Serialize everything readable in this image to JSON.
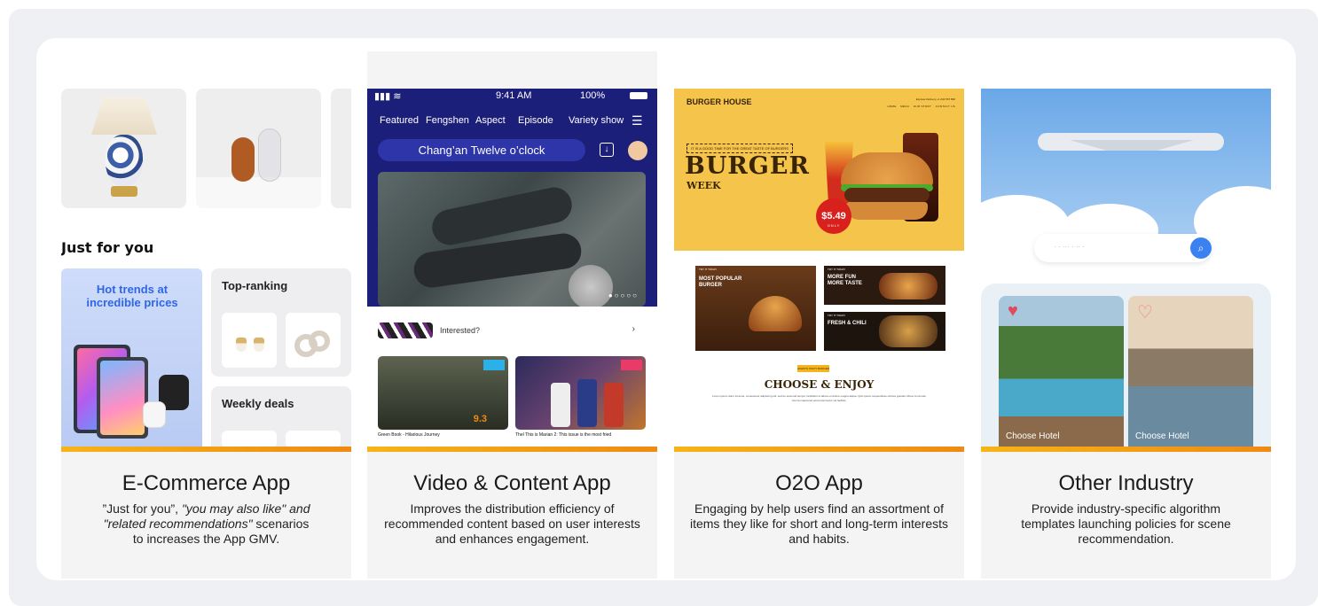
{
  "cards": [
    {
      "id": "ecommerce",
      "title": "E-Commerce App",
      "desc_line1": "”Just for you”, ",
      "desc_line1_italic": "\"you may also like\" and",
      "desc_line2_italic": "\"related recommendations\"",
      "desc_line2": " scenarios",
      "desc_line3": "to increases the App GMV.",
      "screen": {
        "section_title": "Just for you",
        "hot_text": "Hot trends at incredible prices",
        "rank_label": "Top-ranking",
        "deals_label": "Weekly deals"
      }
    },
    {
      "id": "video",
      "title": "Video & Content App",
      "desc": "Improves the distribution efficiency of recommended content based on user interests and enhances engagement.",
      "screen": {
        "time": "9:41 AM",
        "battery": "100%",
        "tabs": [
          "Featured",
          "Fengshen",
          "Aspect",
          "Episode",
          "Variety show"
        ],
        "search_text": "Chang’an Twelve o’clock",
        "interested": "Interested?",
        "rating": "9.3",
        "thumb1_label": "Green Book - Hilarious Journey",
        "thumb2_label": "Thel This is Marian 2: This issue is the most fried"
      }
    },
    {
      "id": "o2o",
      "title": "O2O App",
      "desc": "Engaging by help users find an assortment of items they like for short and long-term interests and habits.",
      "screen": {
        "brand": "BURGER HOUSE",
        "delivery": "Express Delivery +1 234 567 890",
        "menu": [
          "HOME",
          "MENU",
          "OUR STORY",
          "CONTACT US"
        ],
        "tagline": "IT IS A GOOD TIME FOR THE GREAT TASTE OF BURGERS",
        "headline": "BURGER",
        "subheadline": "WEEK",
        "price": "$5.49",
        "only": "ONLY",
        "tile1": "MOST POPULAR BURGER",
        "tile2": "MORE FUN MORE TASTE",
        "tile3": "FRESH & CHILI",
        "try_text": "TRY IT TODAY",
        "always": "ALWAYS TASTY BURGER",
        "choose": "CHOOSE & ENJOY",
        "lorem": "Lorem ipsum dolor sit amet, consectetur adipiscing elit, sed do eiusmod tempor incididunt ut labore et dolore magna aliqua. Quis ipsum suspendisse ultrices gravida. Risus commodo viverra maecenas accumsan lacus vel facilisis."
      }
    },
    {
      "id": "other",
      "title": "Other Industry",
      "desc": "Provide industry-specific algorithm templates launching policies for scene recommendation.",
      "screen": {
        "hotel1": "Choose Hotel",
        "hotel2": "Choose Hotel"
      }
    }
  ],
  "colors": {
    "accent_bar_start": "#f6b417",
    "accent_bar_end": "#f08a12",
    "video_bg": "#1c1f7a",
    "burger_yellow": "#f5c44a",
    "hot_blue": "#2f66e8"
  }
}
